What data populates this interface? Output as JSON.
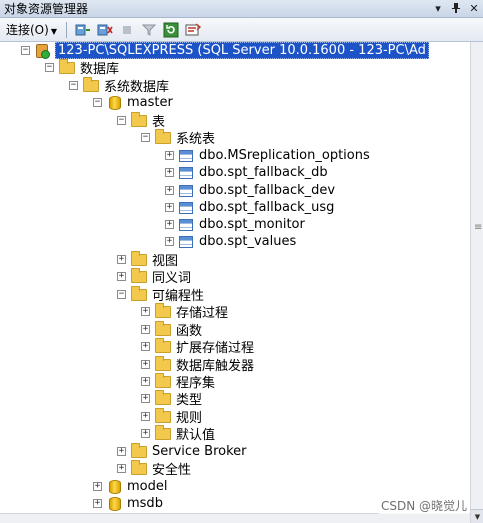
{
  "window": {
    "title": "对象资源管理器",
    "controls": [
      "▾",
      "📌",
      "✕"
    ]
  },
  "toolbar": {
    "connect_label": "连接(O)",
    "icons": [
      "connect-icon",
      "disconnect-icon",
      "stop-icon",
      "filter-icon",
      "refresh-icon",
      "summary-icon"
    ]
  },
  "tree": {
    "server": "123-PC\\SQLEXPRESS (SQL Server 10.0.1600 - 123-PC\\Ad",
    "databases": "数据库",
    "system_databases": "系统数据库",
    "master": "master",
    "tables": "表",
    "system_tables": "系统表",
    "table_items": [
      "dbo.MSreplication_options",
      "dbo.spt_fallback_db",
      "dbo.spt_fallback_dev",
      "dbo.spt_fallback_usg",
      "dbo.spt_monitor",
      "dbo.spt_values"
    ],
    "views": "视图",
    "synonyms": "同义词",
    "programmability": "可编程性",
    "prog_items": [
      "存储过程",
      "函数",
      "扩展存储过程",
      "数据库触发器",
      "程序集",
      "类型",
      "规则",
      "默认值"
    ],
    "service_broker": "Service Broker",
    "security": "安全性",
    "model": "model",
    "msdb": "msdb"
  },
  "watermark": "CSDN @晓觉儿"
}
